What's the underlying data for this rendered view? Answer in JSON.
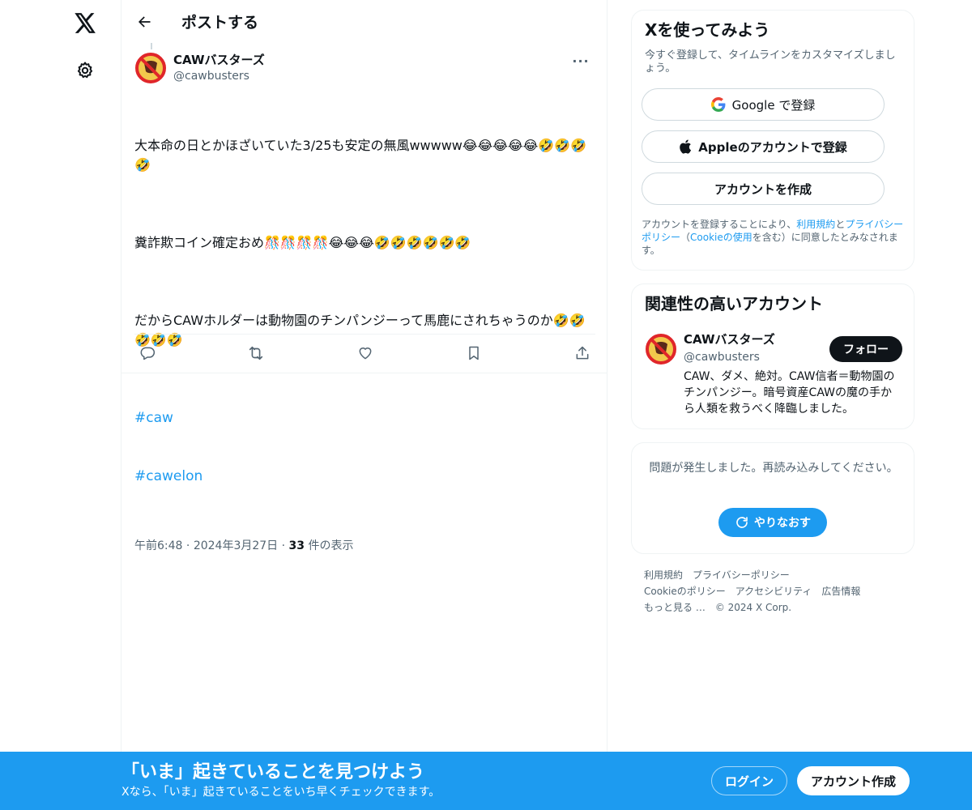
{
  "nav": {
    "logo_icon": "x-logo-icon",
    "settings_icon": "gear-icon"
  },
  "header": {
    "title": "ポストする"
  },
  "post": {
    "author_name": "CAWバスターズ",
    "author_handle": "@cawbusters",
    "paragraphs": [
      "大本命の日とかほざいていた3/25も安定の無風wwwww😂😂😂😂😂🤣🤣🤣🤣",
      "糞詐欺コイン確定おめ🎊🎊🎊🎊😂😂😂🤣🤣🤣🤣🤣🤣",
      "だからCAWホルダーは動物園のチンパンジーって馬鹿にされちゃうのか🤣🤣🤣🤣🤣"
    ],
    "hashtags": [
      "#caw",
      "#cawelon"
    ],
    "time": "午前6:48",
    "date": "2024年3月27日",
    "views_count": "33",
    "views_label": " 件の表示",
    "sep": " · "
  },
  "signup": {
    "title": "Xを使ってみよう",
    "subtitle": "今すぐ登録して、タイムラインをカスタマイズしましょう。",
    "google_label": "Google で登録",
    "apple_label": "Appleのアカウントで登録",
    "create_label": "アカウントを作成",
    "legal_prefix": "アカウントを登録することにより、",
    "legal_terms": "利用規約",
    "legal_and": "と",
    "legal_privacy": "プライバシーポリシー",
    "legal_paren_open": "（",
    "legal_cookie": "Cookieの使用",
    "legal_suffix": "を含む）に同意したとみなされます。"
  },
  "related": {
    "title": "関連性の高いアカウント",
    "name": "CAWバスターズ",
    "handle": "@cawbusters",
    "bio": "CAW、ダメ、絶対。CAW信者＝動物園のチンパンジー。暗号資産CAWの魔の手から人類を救うべく降臨しました。",
    "follow_label": "フォロー"
  },
  "error": {
    "message": "問題が発生しました。再読み込みしてください。",
    "retry_label": "やりなおす"
  },
  "footer": {
    "links": [
      "利用規約",
      "プライバシーポリシー",
      "Cookieのポリシー",
      "アクセシビリティ",
      "広告情報",
      "もっと見る …"
    ],
    "copyright": "© 2024 X Corp."
  },
  "banner": {
    "title": "「いま」起きていることを見つけよう",
    "subtitle": "Xなら、「いま」起きていることをいち早くチェックできます。",
    "login_label": "ログイン",
    "create_label": "アカウント作成"
  },
  "colors": {
    "accent": "#1d9bf0",
    "text": "#0f1419",
    "muted": "#536471"
  }
}
